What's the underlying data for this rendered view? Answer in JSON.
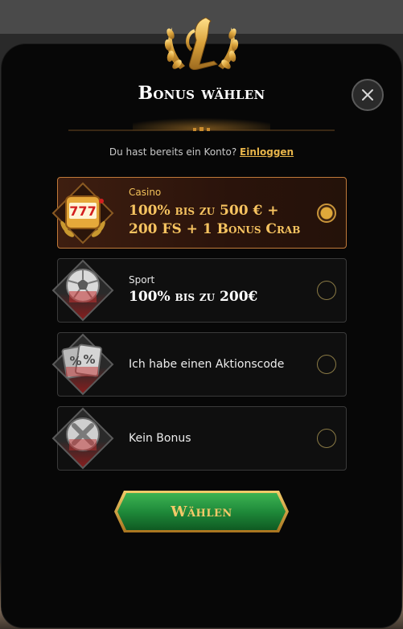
{
  "modal": {
    "title": "Bonus wählen",
    "account_prompt": "Du hast bereits ein Konto?",
    "login_link": "Einloggen",
    "close_icon": "close-icon",
    "logo": "brand-logo-laurel"
  },
  "options": [
    {
      "category": "Casino",
      "headline_line1": "100% bis zu 500 € +",
      "headline_line2": "200 FS + 1 Bonus Crab",
      "icon": "slot-777-icon",
      "selected": true
    },
    {
      "category": "Sport",
      "headline_line1": "100% bis zu 200€",
      "icon": "football-icon",
      "selected": false
    },
    {
      "label": "Ich habe einen Aktionscode",
      "icon": "percent-coupon-icon",
      "selected": false
    },
    {
      "label": "Kein Bonus",
      "icon": "no-bonus-icon",
      "selected": false
    }
  ],
  "cta": {
    "label": "Wählen"
  },
  "colors": {
    "accent_gold": "#e8b54a",
    "modal_bg": "#070707",
    "selected_bg": "#3e1e10",
    "cta_green": "#1f8a3a"
  }
}
